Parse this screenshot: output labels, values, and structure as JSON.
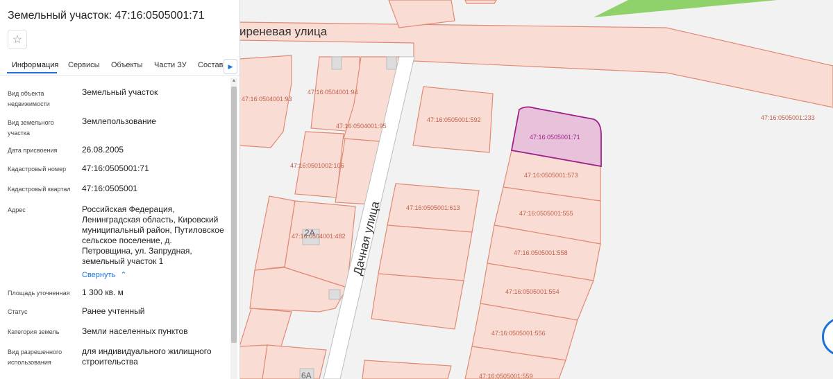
{
  "header": {
    "title": "Земельный участок: 47:16:0505001:71"
  },
  "tabs": [
    {
      "label": "Информация"
    },
    {
      "label": "Сервисы"
    },
    {
      "label": "Объекты"
    },
    {
      "label": "Части ЗУ"
    },
    {
      "label": "Состав"
    }
  ],
  "info": {
    "object_type_label": "Вид объекта недвижимости",
    "object_type_value": "Земельный участок",
    "parcel_type_label": "Вид земельного участка",
    "parcel_type_value": "Землепользование",
    "date_label": "Дата присвоения",
    "date_value": "26.08.2005",
    "cad_number_label": "Кадастровый номер",
    "cad_number_value": "47:16:0505001:71",
    "cad_quarter_label": "Кадастровый квартал",
    "cad_quarter_value": "47:16:0505001",
    "address_label": "Адрес",
    "address_value": "Российская Федерация, Ленинградская область, Кировский муниципальный район, Путиловское сельское поселение, д. Петровщина, ул. Запрудная, земельный участок 1",
    "collapse_label": "Свернуть",
    "area_label": "Площадь уточненная",
    "area_value": "1 300 кв. м",
    "status_label": "Статус",
    "status_value": "Ранее учтенный",
    "category_label": "Категория земель",
    "category_value": "Земли населенных пунктов",
    "use_label": "Вид разрешенного использования",
    "use_value": "для индивидуального жилищного строительства"
  },
  "map": {
    "streets": {
      "top": "иреневая улица",
      "dachnaya": "Дачная улица"
    },
    "parcels": {
      "p93": "47:16:0504001:93",
      "p94": "47:16:0504001:94",
      "p95": "47:16:0504001:95",
      "p106": "47:16:0501002:106",
      "p482": "47:16:0504001:482",
      "p592": "47:16:0505001:592",
      "p71": "47:16:0505001:71",
      "p233": "47:16:0505001:233",
      "p573": "47:16:0505001:573",
      "p613": "47:16:0505001:613",
      "p555": "47:16:0505001:555",
      "p558": "47:16:0505001:558",
      "p554": "47:16:0505001:554",
      "p556": "47:16:0505001:556",
      "p559": "47:16:0505001:559"
    },
    "houses": {
      "h2a": "2А",
      "h6a": "6А"
    }
  },
  "colors": {
    "accent": "#1a73d9",
    "parcel_fill": "#f9ddd4",
    "parcel_stroke": "#e08a75",
    "selected_fill": "#e8c2da",
    "selected_stroke": "#a0208c",
    "green_area": "#8fd16a"
  }
}
